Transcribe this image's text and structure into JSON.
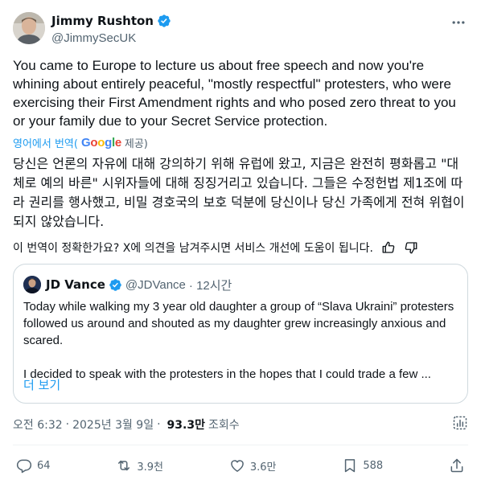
{
  "author": {
    "display_name": "Jimmy Rushton",
    "handle": "@JimmySecUK",
    "verified": true,
    "avatar": "avatar-photo"
  },
  "tweet": {
    "text": "You came to Europe to lecture us about free speech and now you're whining about entirely peaceful, \"mostly respectful\" protesters, who were exercising their First Amendment rights and who posed zero threat to you or your family due to your Secret Service protection.",
    "translated_by_label": "영어에서 번역(",
    "google_label": "Google",
    "provided_label": "제공)",
    "translation": "당신은 언론의 자유에 대해 강의하기 위해 유럽에 왔고, 지금은 완전히 평화롭고 \"대체로 예의 바른\" 시위자들에 대해 징징거리고 있습니다. 그들은 수정헌법 제1조에 따라 권리를 행사했고, 비밀 경호국의 보호 덕분에 당신이나 당신 가족에게 전혀 위협이 되지 않았습니다.",
    "feedback_prompt": "이 번역이 정확한가요? X에 의견을 남겨주시면 서비스 개선에 도움이 됩니다."
  },
  "quote": {
    "display_name": "JD Vance",
    "handle": "@JDVance",
    "time": "· 12시간",
    "paragraph1": "Today while walking my 3 year old daughter a group of “Slava Ukraini” protesters followed us around and shouted as my daughter grew increasingly anxious and scared.",
    "paragraph2": "I decided to speak with the protesters in the hopes that I could trade a few ...",
    "show_more": "더 보기"
  },
  "meta": {
    "time": "오전 6:32",
    "date": "2025년 3월 9일",
    "views": "93.3만",
    "views_label": "조회수"
  },
  "actions": {
    "replies": "64",
    "reposts": "3.9천",
    "likes": "3.6만",
    "bookmarks": "588"
  },
  "colors": {
    "accent": "#1d9bf0",
    "text": "#0f1419",
    "secondary": "#536471",
    "border": "#cfd9de"
  }
}
